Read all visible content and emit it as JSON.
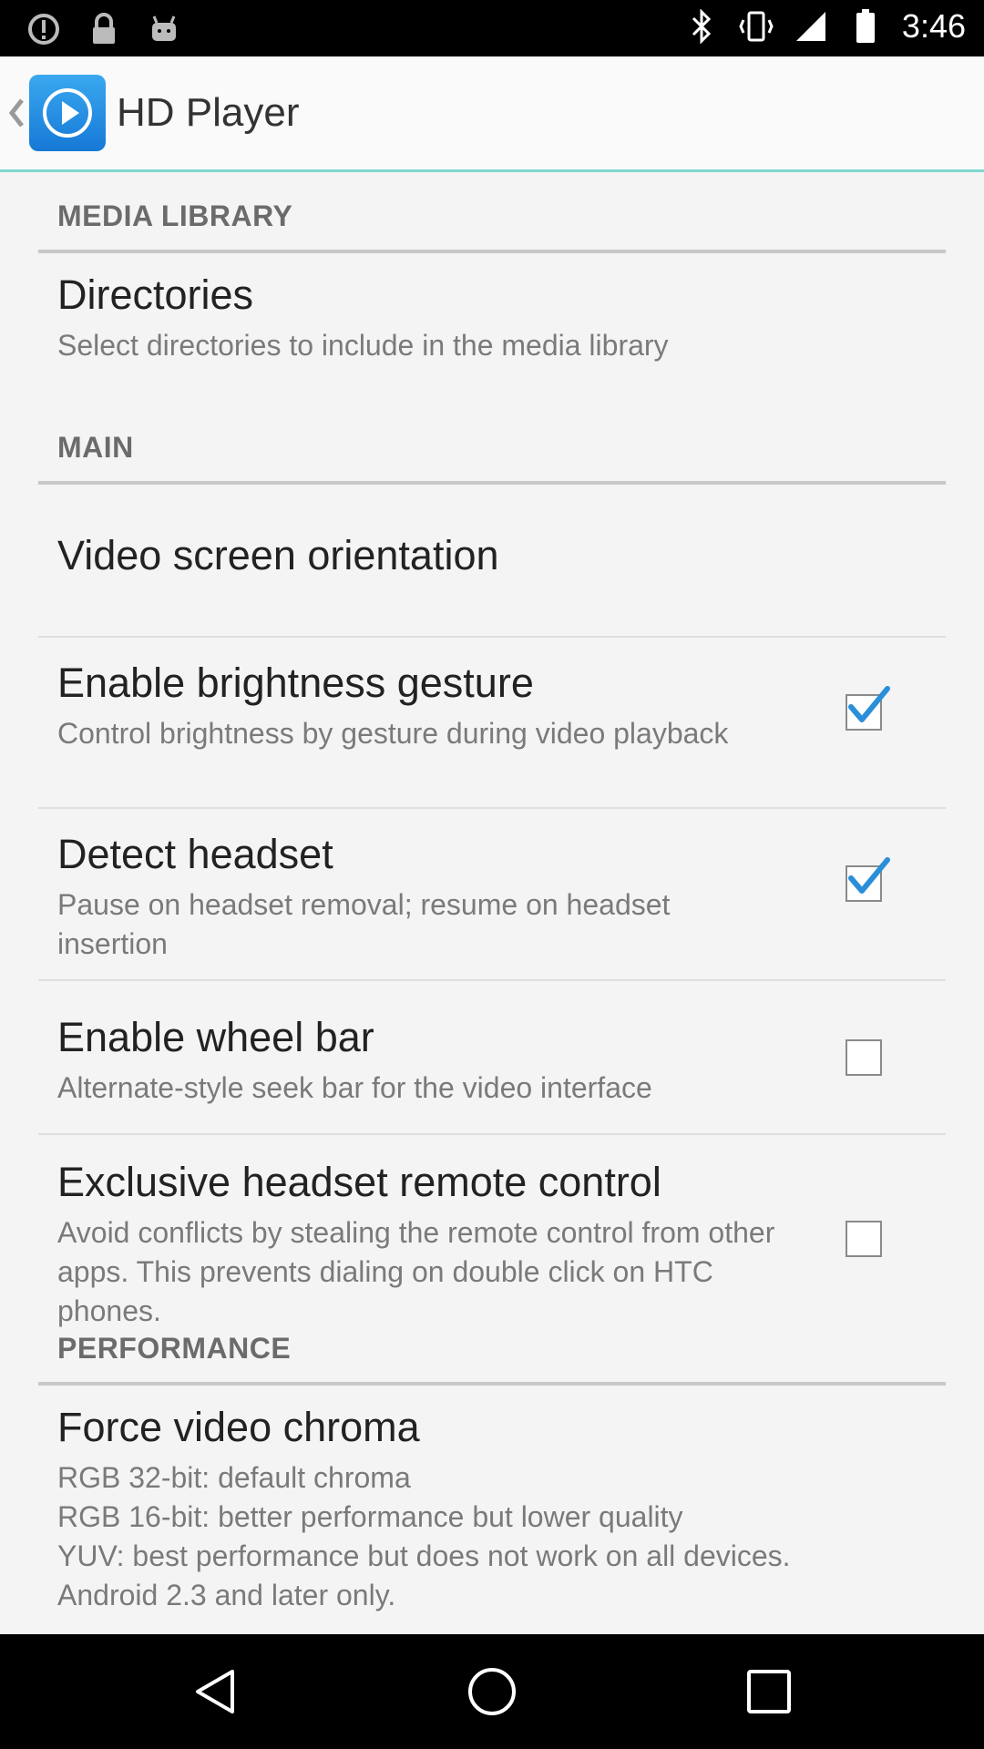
{
  "status_bar": {
    "time": "3:46",
    "left_icons": [
      "alert-circle-icon",
      "lock-icon",
      "android-icon"
    ],
    "right_icons": [
      "bluetooth-icon",
      "vibrate-icon",
      "signal-icon",
      "battery-icon"
    ]
  },
  "app_bar": {
    "title": "HD Player"
  },
  "sections": {
    "media_library": "MEDIA LIBRARY",
    "main": "MAIN",
    "performance": "PERFORMANCE"
  },
  "prefs": {
    "directories": {
      "title": "Directories",
      "summary": "Select directories to include in the media library"
    },
    "orientation": {
      "title": "Video screen orientation"
    },
    "brightness": {
      "title": "Enable brightness gesture",
      "summary": "Control brightness by gesture during video playback",
      "checked": true
    },
    "headset": {
      "title": "Detect headset",
      "summary": "Pause on headset removal; resume on headset insertion",
      "checked": true
    },
    "wheel_bar": {
      "title": "Enable wheel bar",
      "summary": "Alternate-style seek bar for the video interface",
      "checked": false
    },
    "remote_control": {
      "title": "Exclusive headset remote control",
      "summary": "Avoid conflicts by stealing the remote control from other apps. This prevents dialing on double click on HTC phones.",
      "checked": false
    },
    "chroma": {
      "title": "Force video chroma",
      "summary_lines": [
        "RGB 32-bit: default chroma",
        "RGB 16-bit: better performance but lower quality",
        "YUV: best performance but does not work on all devices.",
        "Android 2.3 and later only."
      ]
    }
  },
  "colors": {
    "accent": "#7fd6cf",
    "check": "#2a8fd8"
  }
}
